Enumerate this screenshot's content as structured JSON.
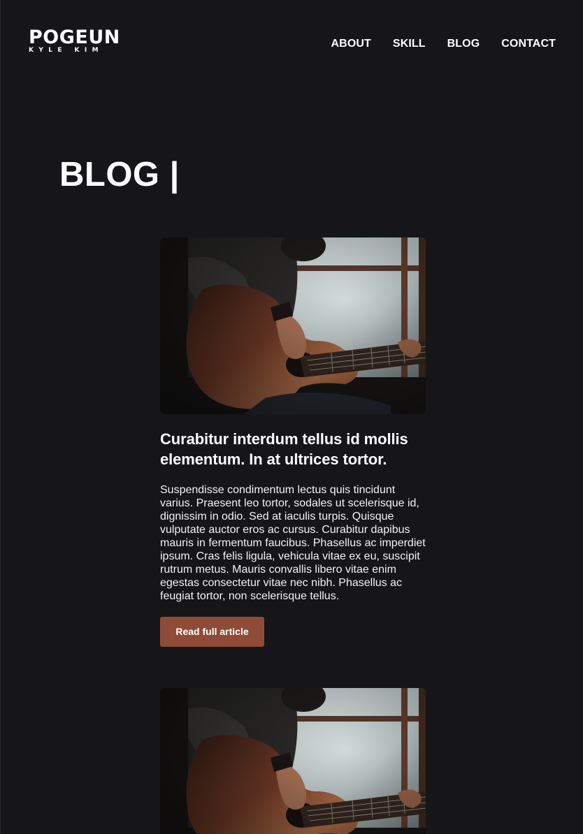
{
  "header": {
    "logo_main": "POGEUN",
    "logo_sub": "KYLE KIM",
    "nav": [
      "ABOUT",
      "SKILL",
      "BLOG",
      "CONTACT"
    ]
  },
  "page_title": "BLOG |",
  "posts": [
    {
      "image": "guitar-player-photo",
      "title": "Curabitur interdum tellus id mollis elementum. In at ultrices tortor.",
      "excerpt": "Suspendisse condimentum lectus quis tincidunt varius. Praesent leo tortor, sodales ut scelerisque id, dignissim in odio. Sed at iaculis turpis. Quisque vulputate auctor eros ac cursus. Curabitur dapibus mauris in fermentum faucibus. Phasellus ac imperdiet ipsum. Cras felis ligula, vehicula vitae ex eu, suscipit rutrum metus. Mauris convallis libero vitae enim egestas consectetur vitae nec nibh. Phasellus ac feugiat tortor, non scelerisque tellus.",
      "button_label": "Read full article"
    },
    {
      "image": "guitar-player-photo"
    }
  ],
  "colors": {
    "background": "#161618",
    "button": "#8e4b37",
    "text": "#ffffff"
  }
}
